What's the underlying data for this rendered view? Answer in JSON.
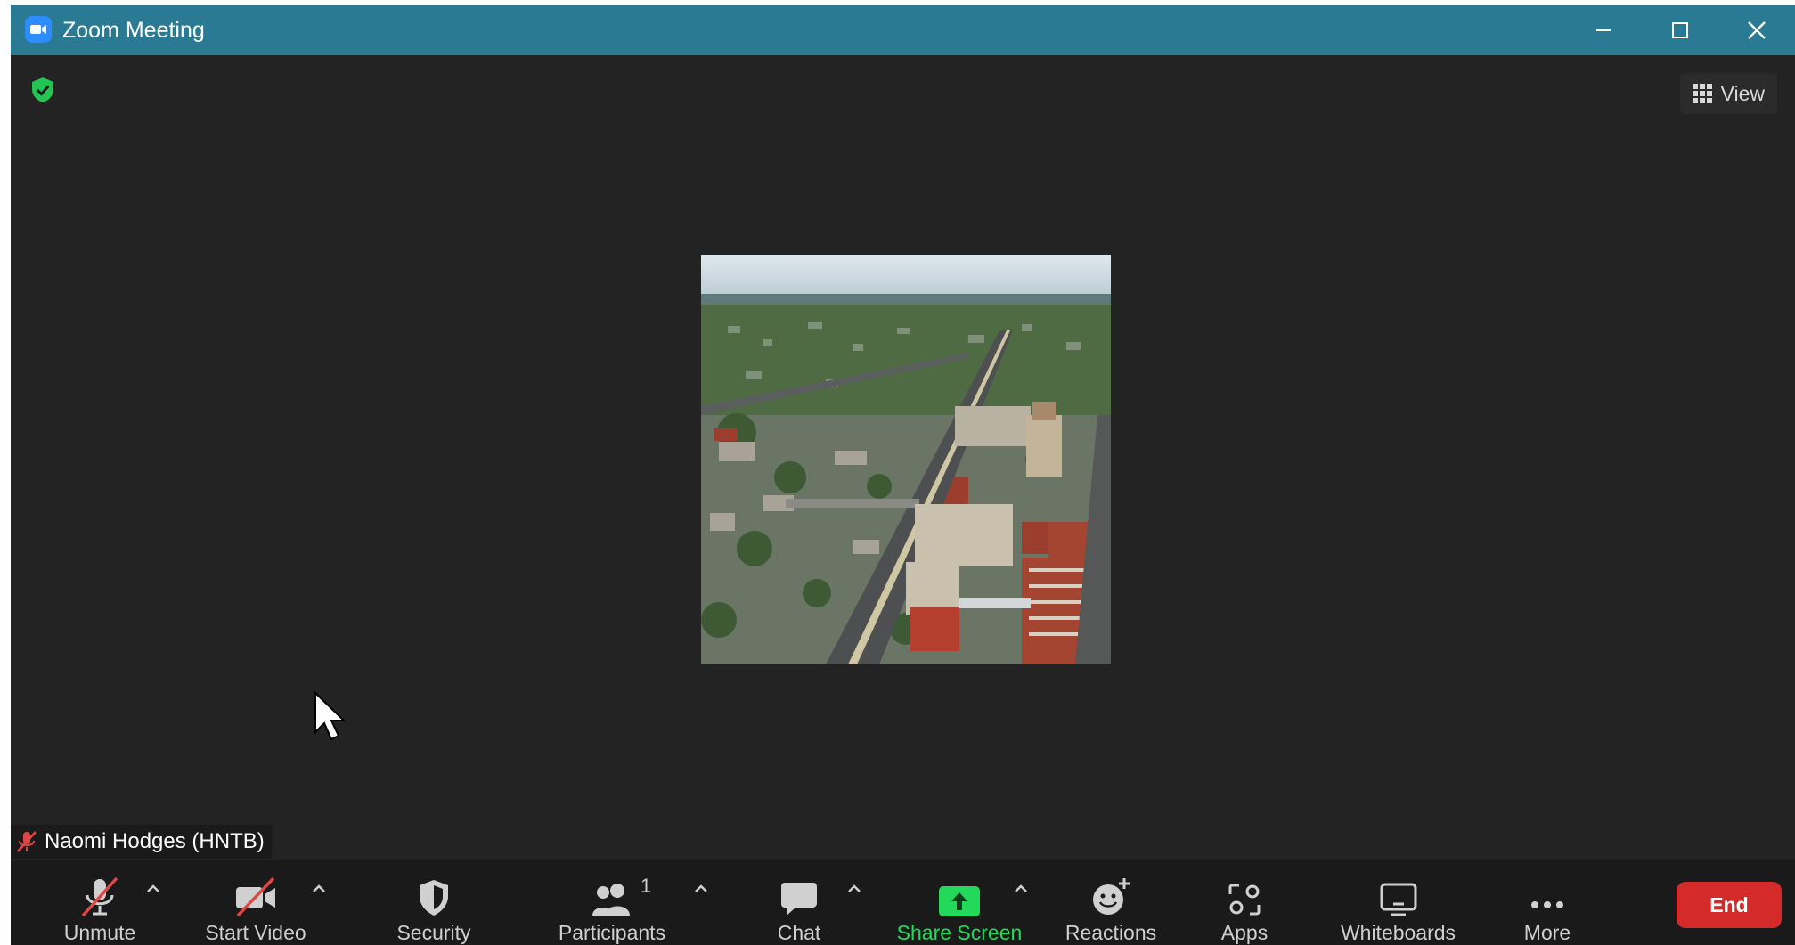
{
  "window": {
    "title": "Zoom Meeting",
    "title_bar_color": "#2a7a93"
  },
  "view_button": {
    "label": "View"
  },
  "participant": {
    "name": "Naomi Hodges (HNTB)",
    "muted": true
  },
  "toolbar": {
    "unmute_label": "Unmute",
    "start_video_label": "Start Video",
    "security_label": "Security",
    "participants_label": "Participants",
    "participants_count": "1",
    "chat_label": "Chat",
    "share_screen_label": "Share Screen",
    "reactions_label": "Reactions",
    "apps_label": "Apps",
    "whiteboards_label": "Whiteboards",
    "more_label": "More",
    "end_label": "End",
    "share_color": "#23d959",
    "end_color": "#d42a2a"
  },
  "icons": {
    "encryption": "shield-check-icon",
    "grid": "grid-icon",
    "mic_off": "microphone-off-icon",
    "video_off": "video-off-icon",
    "security": "shield-icon",
    "participants": "people-icon",
    "chat": "chat-bubble-icon",
    "share": "share-arrow-up-icon",
    "reactions": "emoji-plus-icon",
    "apps": "apps-icon",
    "whiteboards": "whiteboard-icon",
    "more": "more-dots-icon"
  }
}
